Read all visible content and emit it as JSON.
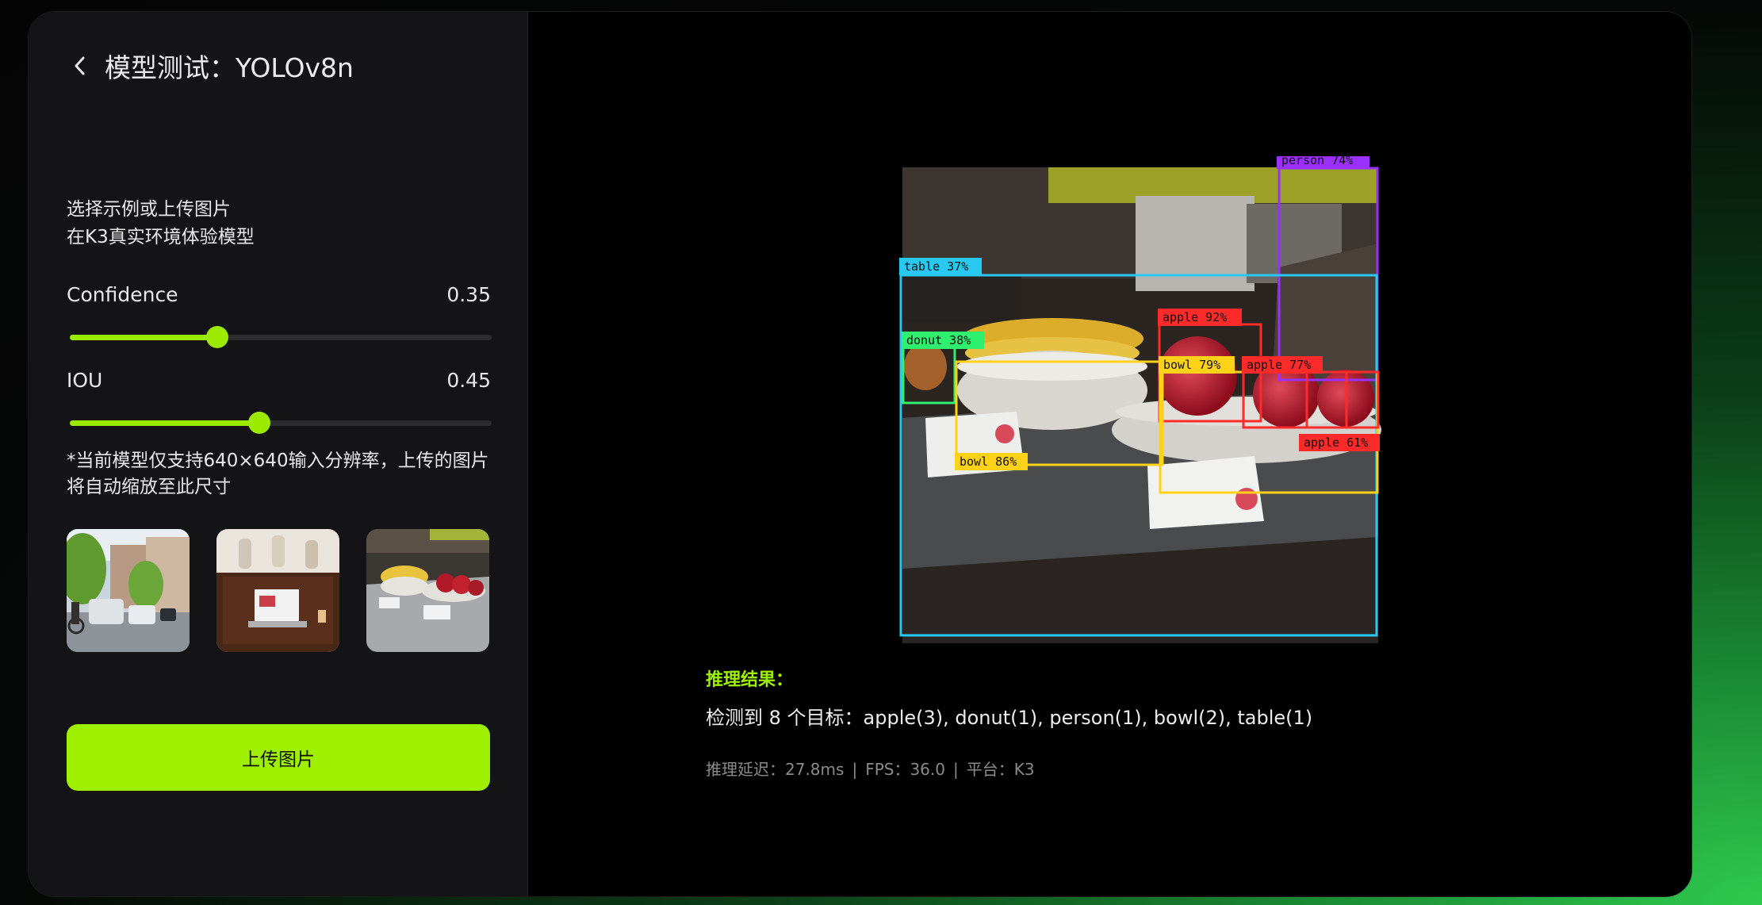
{
  "header": {
    "title": "模型测试：YOLOv8n"
  },
  "intro": {
    "line1": "选择示例或上传图片",
    "line2": "在K3真实环境体验模型"
  },
  "confidence": {
    "label": "Confidence",
    "value": "0.35",
    "fraction": 0.35
  },
  "iou": {
    "label": "IOU",
    "value": "0.45",
    "fraction": 0.45
  },
  "note": "*当前模型仅支持640×640输入分辨率，上传的图片将自动缩放至此尺寸",
  "upload": {
    "label": "上传图片"
  },
  "colors": {
    "accent": "#9ef000",
    "panel": "#141416"
  },
  "detections": [
    {
      "label": "person 74%",
      "color": "#9b30ff"
    },
    {
      "label": "table 37%",
      "color": "#29c8f0"
    },
    {
      "label": "apple 92%",
      "color": "#ff2a2a"
    },
    {
      "label": "donut 38%",
      "color": "#2ef06e"
    },
    {
      "label": "bowl 79%",
      "color": "#ffd21a"
    },
    {
      "label": "apple 77%",
      "color": "#ff2a2a"
    },
    {
      "label": "apple 61%",
      "color": "#ff2a2a"
    },
    {
      "label": "bowl 86%",
      "color": "#ffd21a"
    }
  ],
  "result": {
    "title": "推理结果：",
    "text": "检测到 8 个目标：apple(3), donut(1), person(1), bowl(2), table(1)",
    "latency": "推理延迟：27.8ms",
    "fps": "FPS：36.0",
    "platform": "平台：K3"
  }
}
